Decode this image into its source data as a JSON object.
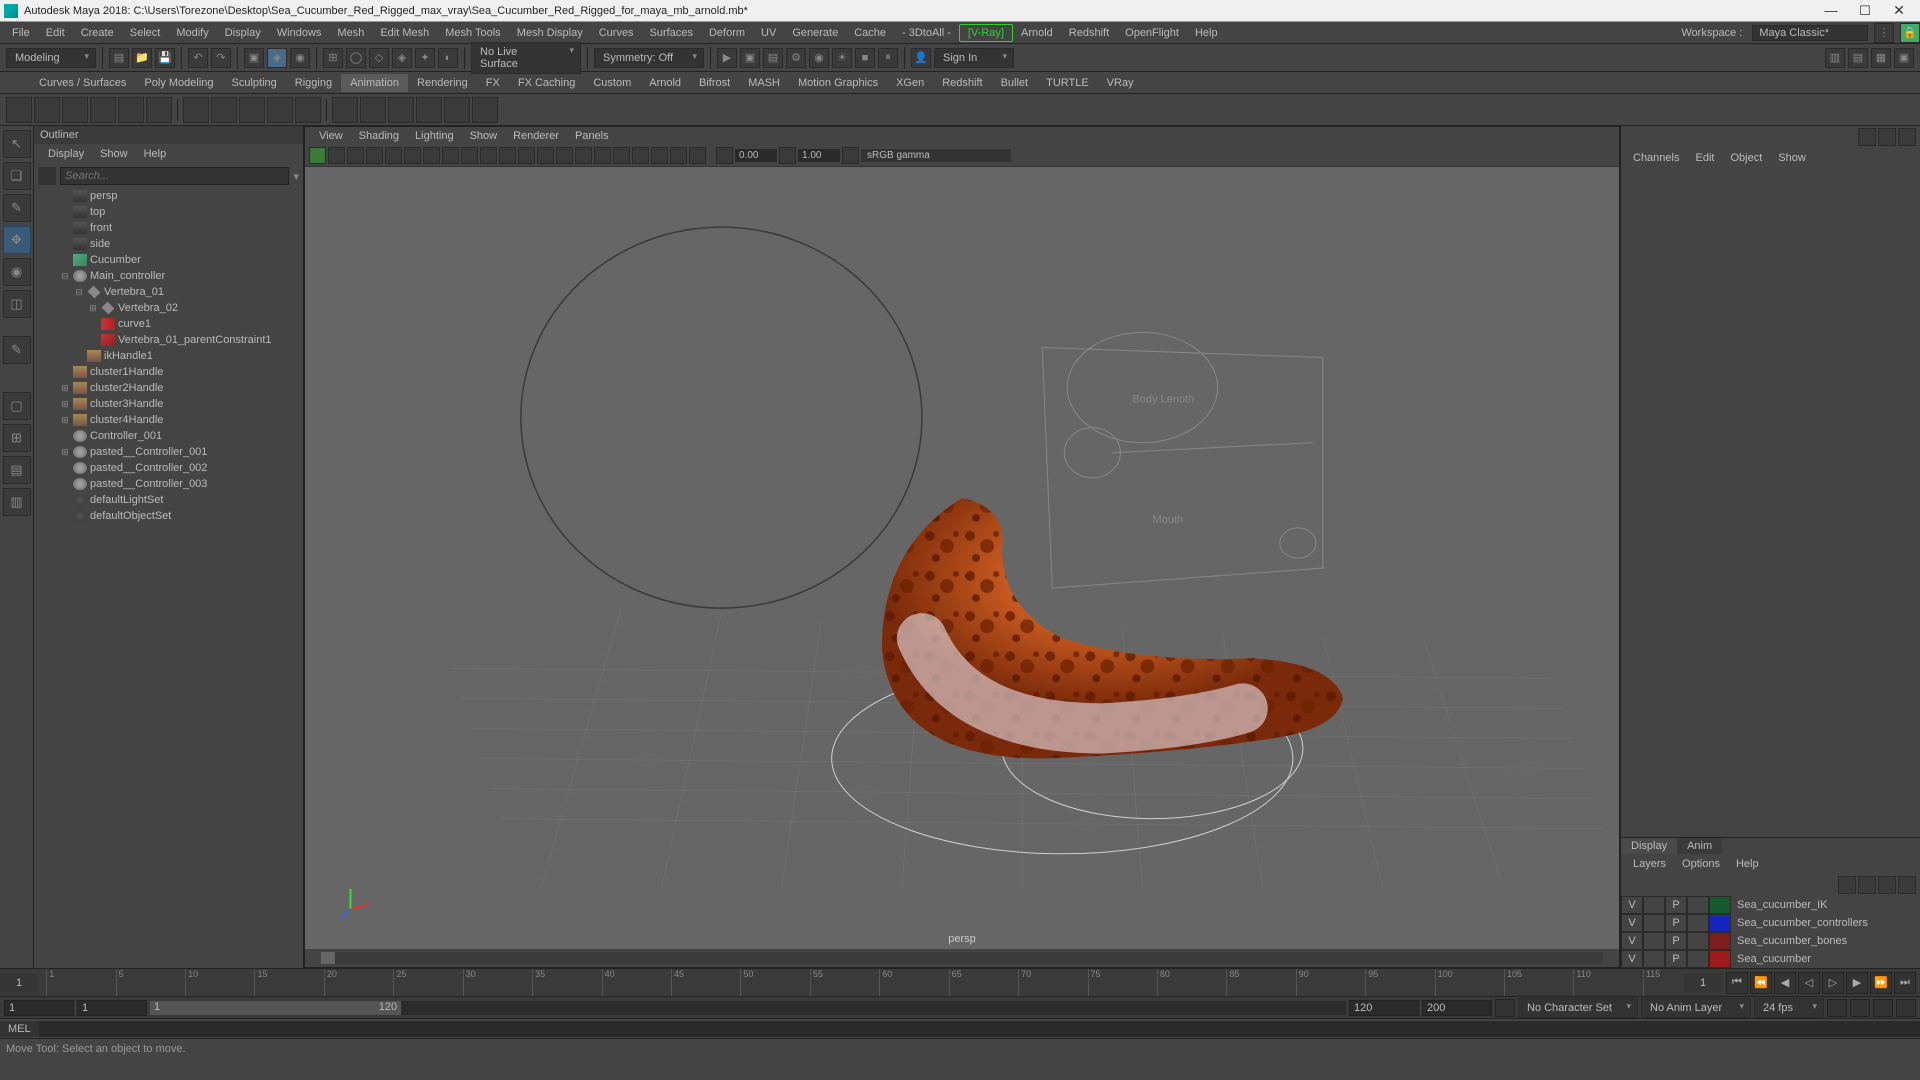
{
  "window": {
    "title": "Autodesk Maya 2018: C:\\Users\\Torezone\\Desktop\\Sea_Cucumber_Red_Rigged_max_vray\\Sea_Cucumber_Red_Rigged_for_maya_mb_arnold.mb*"
  },
  "menubar": {
    "items": [
      "File",
      "Edit",
      "Create",
      "Select",
      "Modify",
      "Display",
      "Windows",
      "Mesh",
      "Edit Mesh",
      "Mesh Tools",
      "Mesh Display",
      "Curves",
      "Surfaces",
      "Deform",
      "UV",
      "Generate",
      "Cache",
      "- 3DtoAll -",
      "[V-Ray]",
      "Arnold",
      "Redshift",
      "OpenFlight",
      "Help"
    ],
    "workspace_label": "Workspace :",
    "workspace_value": "Maya Classic*"
  },
  "shelf1": {
    "mode": "Modeling",
    "live": "No Live Surface",
    "symmetry": "Symmetry: Off",
    "signin": "Sign In"
  },
  "shelf2": {
    "tabs": [
      "Curves / Surfaces",
      "Poly Modeling",
      "Sculpting",
      "Rigging",
      "Animation",
      "Rendering",
      "FX",
      "FX Caching",
      "Custom",
      "Arnold",
      "Bifrost",
      "MASH",
      "Motion Graphics",
      "XGen",
      "Redshift",
      "Bullet",
      "TURTLE",
      "VRay"
    ],
    "active": "Animation"
  },
  "outliner": {
    "title": "Outliner",
    "menus": [
      "Display",
      "Show",
      "Help"
    ],
    "search_placeholder": "Search...",
    "items": [
      {
        "indent": 1,
        "icon": "cam",
        "label": "persp"
      },
      {
        "indent": 1,
        "icon": "cam",
        "label": "top"
      },
      {
        "indent": 1,
        "icon": "cam",
        "label": "front"
      },
      {
        "indent": 1,
        "icon": "cam",
        "label": "side"
      },
      {
        "indent": 1,
        "icon": "mesh",
        "label": "Cucumber"
      },
      {
        "indent": 1,
        "icon": "ctrl",
        "label": "Main_controller",
        "exp": "⊟"
      },
      {
        "indent": 2,
        "icon": "bone",
        "label": "Vertebra_01",
        "exp": "⊟"
      },
      {
        "indent": 3,
        "icon": "bone",
        "label": "Vertebra_02",
        "exp": "⊞"
      },
      {
        "indent": 3,
        "icon": "curve",
        "label": "curve1"
      },
      {
        "indent": 3,
        "icon": "constraint",
        "label": "Vertebra_01_parentConstraint1"
      },
      {
        "indent": 2,
        "icon": "handle",
        "label": "ikHandle1"
      },
      {
        "indent": 1,
        "icon": "handle",
        "label": "cluster1Handle"
      },
      {
        "indent": 1,
        "icon": "handle",
        "label": "cluster2Handle",
        "exp": "⊞"
      },
      {
        "indent": 1,
        "icon": "handle",
        "label": "cluster3Handle",
        "exp": "⊞"
      },
      {
        "indent": 1,
        "icon": "handle",
        "label": "cluster4Handle",
        "exp": "⊞"
      },
      {
        "indent": 1,
        "icon": "ctrl",
        "label": "Controller_001"
      },
      {
        "indent": 1,
        "icon": "ctrl",
        "label": "pasted__Controller_001",
        "exp": "⊞"
      },
      {
        "indent": 1,
        "icon": "ctrl",
        "label": "pasted__Controller_002"
      },
      {
        "indent": 1,
        "icon": "ctrl",
        "label": "pasted__Controller_003"
      },
      {
        "indent": 1,
        "icon": "set",
        "label": "defaultLightSet"
      },
      {
        "indent": 1,
        "icon": "set",
        "label": "defaultObjectSet"
      }
    ]
  },
  "viewport": {
    "menus": [
      "View",
      "Shading",
      "Lighting",
      "Show",
      "Renderer",
      "Panels"
    ],
    "val1": "0.00",
    "val2": "1.00",
    "colorspace": "sRGB gamma",
    "label_body": "Body Lenoth",
    "label_mouth": "Mouth",
    "camera": "persp"
  },
  "channelbox": {
    "menus": [
      "Channels",
      "Edit",
      "Object",
      "Show"
    ]
  },
  "layers": {
    "tabs": [
      "Display",
      "Anim"
    ],
    "menus": [
      "Layers",
      "Options",
      "Help"
    ],
    "rows": [
      {
        "v": "V",
        "p": "P",
        "color": "#175a2e",
        "name": "Sea_cucumber_IK"
      },
      {
        "v": "V",
        "p": "P",
        "color": "#1525c0",
        "name": "Sea_cucumber_controllers"
      },
      {
        "v": "V",
        "p": "P",
        "color": "#7d1d1d",
        "name": "Sea_cucumber_bones"
      },
      {
        "v": "V",
        "p": "P",
        "color": "#a01a1a",
        "name": "Sea_cucumber"
      }
    ]
  },
  "timeslider": {
    "start": "1",
    "end_field": "1",
    "ticks": [
      "1",
      "5",
      "10",
      "15",
      "20",
      "25",
      "30",
      "35",
      "40",
      "45",
      "50",
      "55",
      "60",
      "65",
      "70",
      "75",
      "80",
      "85",
      "90",
      "95",
      "100",
      "105",
      "110",
      "115"
    ]
  },
  "range": {
    "start": "1",
    "anim_start": "1",
    "thumb_start": "1",
    "thumb_end": "120",
    "anim_end": "120",
    "end": "200",
    "charset": "No Character Set",
    "animlayer": "No Anim Layer",
    "fps": "24 fps"
  },
  "cmd": {
    "lang": "MEL"
  },
  "status": {
    "text": "Move Tool: Select an object to move."
  }
}
